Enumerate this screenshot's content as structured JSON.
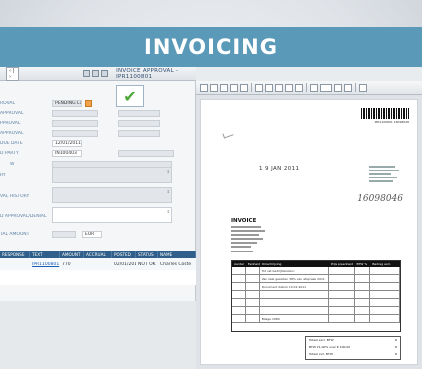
{
  "banner": {
    "title": "INVOICING"
  },
  "app": {
    "nav_arrows": "‹ | ›",
    "window_title": "INVOICE APPROVAL - IPR1100801"
  },
  "form": {
    "approve_glyph": "✔",
    "fields": [
      {
        "label": "ROVAL",
        "value": "PENDING L1"
      },
      {
        "label": "APPROVAL",
        "value": ""
      },
      {
        "label": "PPROVAL",
        "value": ""
      },
      {
        "label": "APPROVAL",
        "value": ""
      },
      {
        "label": "DUE DATE",
        "value": "12/01/2011"
      },
      {
        "label": "D PARTY",
        "value": "IN100403"
      },
      {
        "label": "W",
        "value": ""
      },
      {
        "label": "RY",
        "value": ""
      },
      {
        "label": "VAL HISTORY",
        "value": ""
      },
      {
        "label": "D APPROVAL/DENIAL",
        "value": ""
      },
      {
        "label": "TAL AMOUNT",
        "value": "EUR"
      }
    ],
    "grid": {
      "headers": [
        "RESPONSE",
        "TEXT",
        "AMOUNT",
        "ACCRUAL",
        "POSTED",
        "STATUS",
        "NAME"
      ],
      "rows": [
        [
          "",
          "IPR1100801",
          "770",
          "",
          "02/01/2011",
          "NOT OK",
          "Charles Coste"
        ]
      ],
      "extra_cell": "46"
    }
  },
  "viewer": {
    "barcode_text": "IPR1100801 16098046",
    "stamp_date": "1 9 JAN 2011",
    "signature": "16098046",
    "doc_title": "INVOICE",
    "table_headers": [
      "Aantal",
      "Eenheid",
      "Omschrijving",
      "Prijs p/eenheid",
      "BTW %",
      "Bedrag excl."
    ],
    "table_rows": [
      [
        "",
        "",
        "Tot vst bedrijfskosten:",
        "",
        "",
        ""
      ],
      [
        "",
        "",
        "Van zaal gesloten 38% van afspraak 2011",
        "",
        "",
        ""
      ],
      [
        "",
        "",
        "Document datum 10.01.2011",
        "",
        "",
        ""
      ],
      [
        "",
        "",
        "",
        "",
        "",
        ""
      ],
      [
        "",
        "",
        "",
        "",
        "",
        ""
      ],
      [
        "",
        "",
        "",
        "",
        "",
        ""
      ],
      [
        "",
        "",
        "Bilage 1989",
        "",
        "",
        ""
      ]
    ],
    "totals": [
      {
        "label": "Totaal excl. BTW",
        "value": "€"
      },
      {
        "label": "BTW 21,00% over € 100,00",
        "value": "€"
      },
      {
        "label": "Totaal incl. BTW",
        "value": "€"
      }
    ]
  }
}
